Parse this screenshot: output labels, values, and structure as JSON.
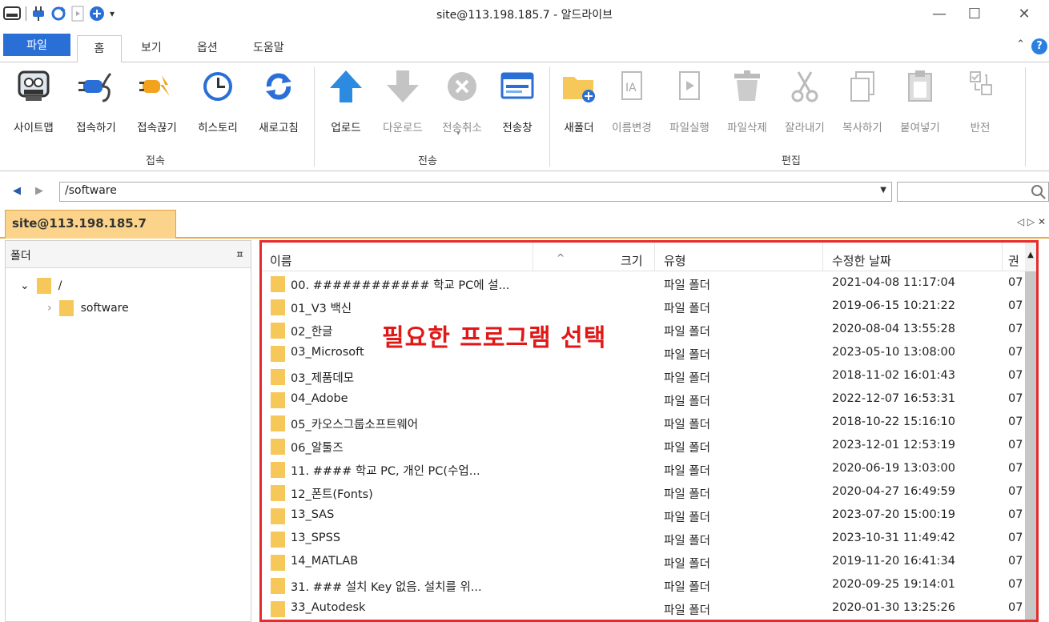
{
  "window": {
    "title": "site@113.198.185.7 - 알드라이브",
    "minimize": "—",
    "maximize": "☐",
    "close": "✕"
  },
  "menu": {
    "tabs": [
      "파일",
      "홈",
      "보기",
      "옵션",
      "도움말"
    ],
    "active": "홈",
    "help": "?",
    "collapse": "⌃"
  },
  "ribbon": {
    "connect": {
      "group": "접속",
      "buttons": [
        {
          "label": "사이트맵",
          "icon": "sitemap-icon"
        },
        {
          "label": "접속하기",
          "icon": "plug-icon"
        },
        {
          "label": "접속끊기",
          "icon": "unplug-icon"
        },
        {
          "label": "히스토리",
          "icon": "clock-icon"
        },
        {
          "label": "새로고침",
          "icon": "refresh-icon"
        }
      ]
    },
    "transfer": {
      "group": "전송",
      "buttons": [
        {
          "label": "업로드",
          "icon": "upload-arrow-icon",
          "enabled": true
        },
        {
          "label": "다운로드",
          "icon": "download-arrow-icon",
          "enabled": false
        },
        {
          "label": "전송취소",
          "icon": "cancel-icon",
          "enabled": false
        },
        {
          "label": "전송창",
          "icon": "transfer-window-icon",
          "enabled": true
        }
      ]
    },
    "edit": {
      "group": "편집",
      "buttons": [
        {
          "label": "새폴더",
          "icon": "new-folder-icon",
          "enabled": true
        },
        {
          "label": "이름변경",
          "icon": "rename-icon",
          "enabled": false
        },
        {
          "label": "파일실행",
          "icon": "run-file-icon",
          "enabled": false
        },
        {
          "label": "파일삭제",
          "icon": "trash-icon",
          "enabled": false
        },
        {
          "label": "잘라내기",
          "icon": "scissors-icon",
          "enabled": false
        },
        {
          "label": "복사하기",
          "icon": "copy-icon",
          "enabled": false
        },
        {
          "label": "붙여넣기",
          "icon": "paste-icon",
          "enabled": false
        },
        {
          "label": "반전",
          "icon": "invert-select-icon",
          "enabled": false
        }
      ]
    }
  },
  "address": {
    "path": "/software",
    "search_value": ""
  },
  "connection_tab": {
    "label": "site@113.198.185.7",
    "nav": "◁ ▷ ✕"
  },
  "folder_pane": {
    "header": "폴더",
    "pin": "📌",
    "tree": [
      {
        "label": "/",
        "expander": "⌄"
      },
      {
        "label": "software",
        "expander": "›"
      }
    ]
  },
  "file_list": {
    "columns": [
      "이름",
      "크기",
      "유형",
      "수정한 날짜",
      "권"
    ],
    "annotation": "필요한 프로그램 선택",
    "rows": [
      {
        "name": "00. ############ 학교 PC에 설...",
        "type": "파일 폴더",
        "modified": "2021-04-08 11:17:04",
        "perm": "07"
      },
      {
        "name": "01_V3 백신",
        "type": "파일 폴더",
        "modified": "2019-06-15 10:21:22",
        "perm": "07"
      },
      {
        "name": "02_한글",
        "type": "파일 폴더",
        "modified": "2020-08-04 13:55:28",
        "perm": "07"
      },
      {
        "name": "03_Microsoft",
        "type": "파일 폴더",
        "modified": "2023-05-10 13:08:00",
        "perm": "07"
      },
      {
        "name": "03_제품데모",
        "type": "파일 폴더",
        "modified": "2018-11-02 16:01:43",
        "perm": "07"
      },
      {
        "name": "04_Adobe",
        "type": "파일 폴더",
        "modified": "2022-12-07 16:53:31",
        "perm": "07"
      },
      {
        "name": "05_카오스그룹소프트웨어",
        "type": "파일 폴더",
        "modified": "2018-10-22 15:16:10",
        "perm": "07"
      },
      {
        "name": "06_알툴즈",
        "type": "파일 폴더",
        "modified": "2023-12-01 12:53:19",
        "perm": "07"
      },
      {
        "name": "11. #### 학교 PC, 개인 PC(수업...",
        "type": "파일 폴더",
        "modified": "2020-06-19 13:03:00",
        "perm": "07"
      },
      {
        "name": "12_폰트(Fonts)",
        "type": "파일 폴더",
        "modified": "2020-04-27 16:49:59",
        "perm": "07"
      },
      {
        "name": "13_SAS",
        "type": "파일 폴더",
        "modified": "2023-07-20 15:00:19",
        "perm": "07"
      },
      {
        "name": "13_SPSS",
        "type": "파일 폴더",
        "modified": "2023-10-31 11:49:42",
        "perm": "07"
      },
      {
        "name": "14_MATLAB",
        "type": "파일 폴더",
        "modified": "2019-11-20 16:41:34",
        "perm": "07"
      },
      {
        "name": "31. ### 설치 Key 없음. 설치를 위...",
        "type": "파일 폴더",
        "modified": "2020-09-25 19:14:01",
        "perm": "07"
      },
      {
        "name": "33_Autodesk",
        "type": "파일 폴더",
        "modified": "2020-01-30 13:25:26",
        "perm": "07"
      }
    ]
  },
  "colors": {
    "accent": "#2a6fd6",
    "conn_tab": "#fbd38a",
    "highlight_border": "#e52b2b",
    "annotation": "#e01818",
    "folder": "#f6c85a"
  }
}
